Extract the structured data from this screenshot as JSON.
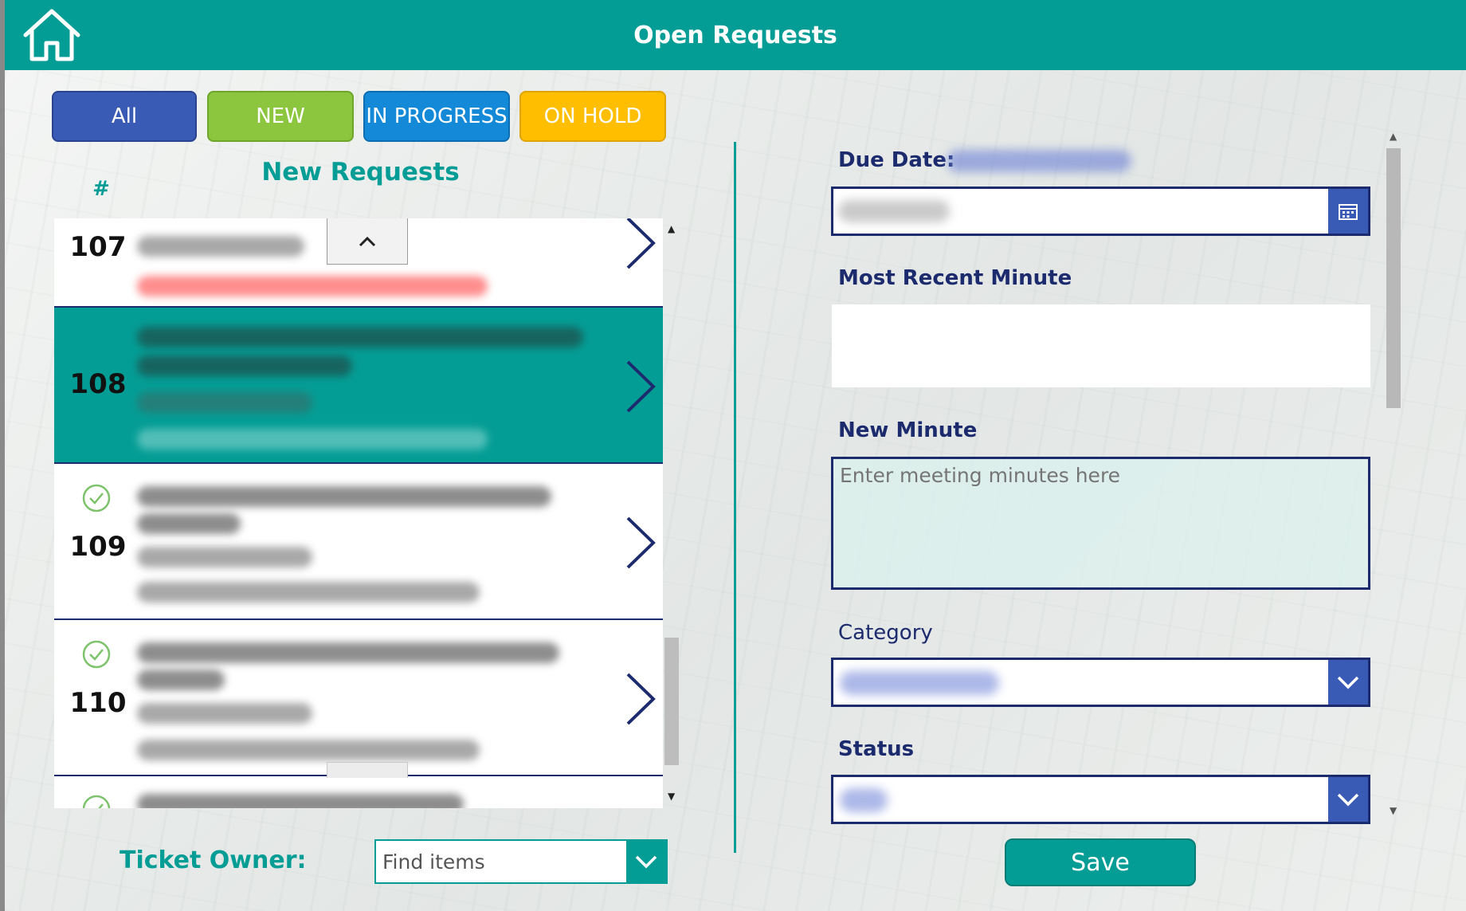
{
  "header": {
    "title": "Open Requests"
  },
  "filters": {
    "all": "All",
    "new": "NEW",
    "in_progress": "IN PROGRESS",
    "on_hold": "ON HOLD"
  },
  "list": {
    "title": "New Requests",
    "hash_label": "#",
    "rows": [
      {
        "number": "107",
        "checked": false,
        "selected": false
      },
      {
        "number": "108",
        "checked": false,
        "selected": true
      },
      {
        "number": "109",
        "checked": true,
        "selected": false
      },
      {
        "number": "110",
        "checked": true,
        "selected": false
      }
    ]
  },
  "owner": {
    "label": "Ticket Owner:",
    "placeholder": "Find items"
  },
  "form": {
    "due_date_label": "Due Date:",
    "recent_minute_label": "Most Recent Minute",
    "new_minute_label": "New Minute",
    "new_minute_placeholder": "Enter meeting minutes here",
    "category_label": "Category",
    "status_label": "Status",
    "save_label": "Save"
  },
  "colors": {
    "teal": "#049d95",
    "navy": "#1c2a6e",
    "blue": "#3a5bb5",
    "green": "#8cc63f",
    "sky": "#1389d8",
    "amber": "#ffbf00"
  },
  "icons": {
    "home": "home-icon",
    "chevron_right": "chevron-right-icon",
    "check": "check-circle-icon",
    "calendar": "calendar-icon",
    "chevron_down": "chevron-down-icon",
    "chevron_up": "chevron-up-icon"
  }
}
